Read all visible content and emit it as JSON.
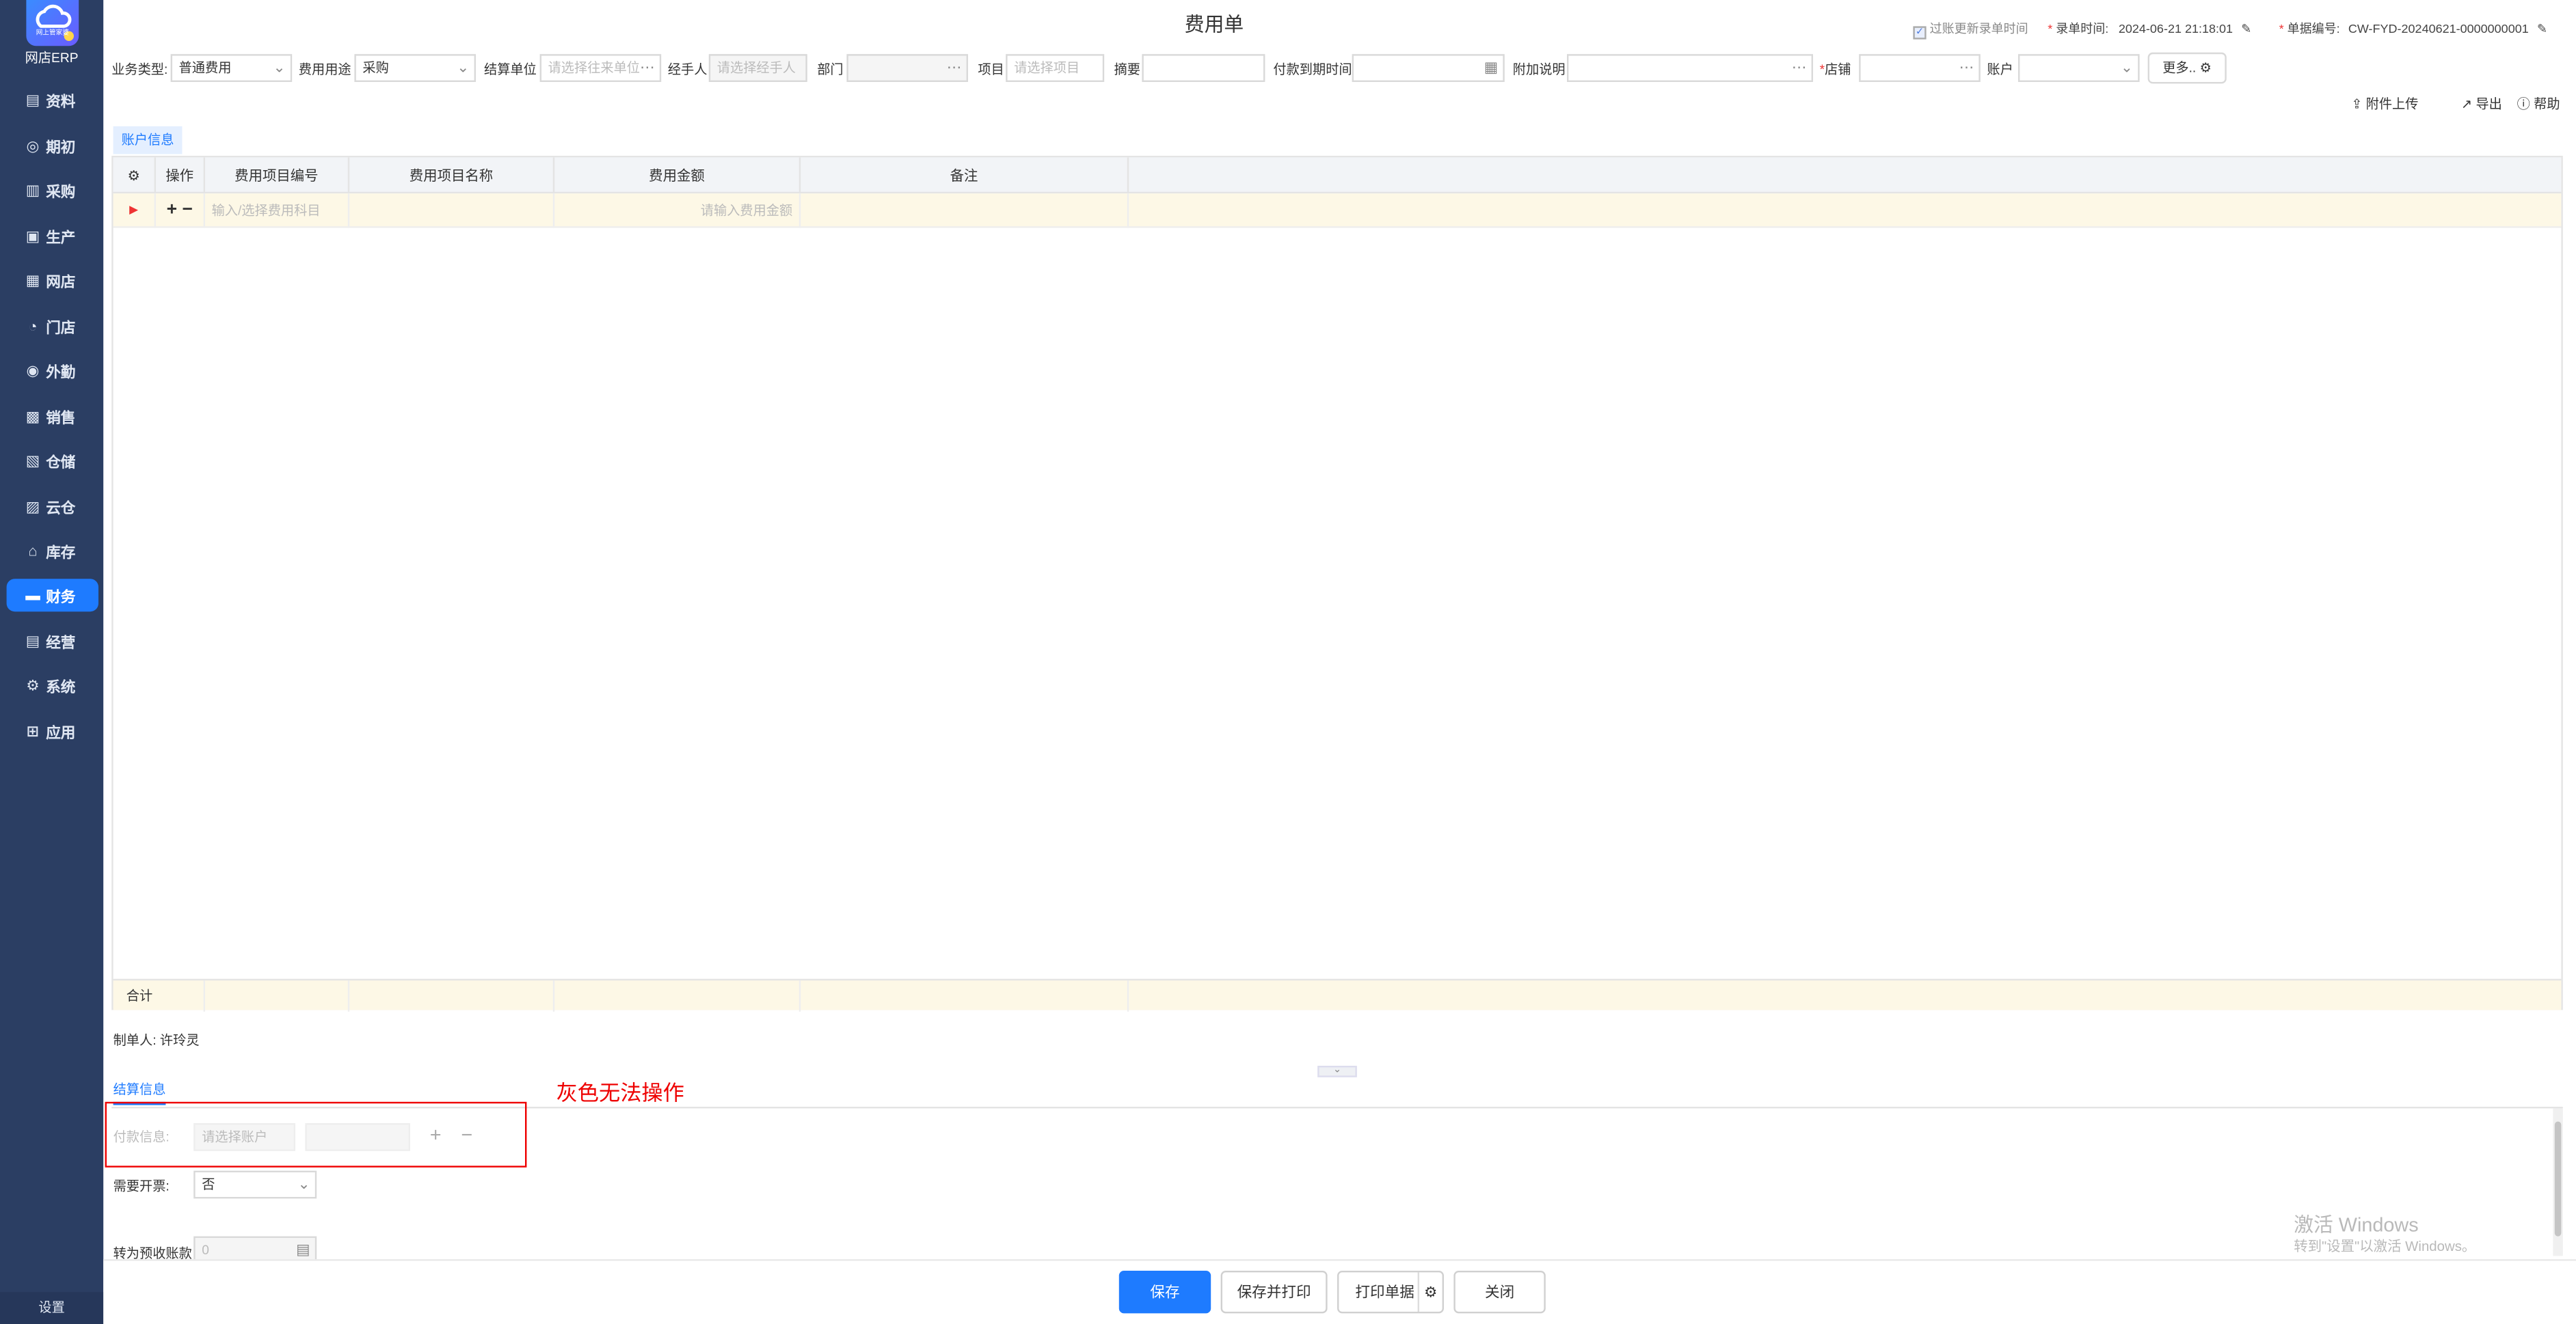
{
  "sidebar": {
    "app_name": "网店ERP",
    "logo_badge": "网上管家婆",
    "items": [
      {
        "label": "资料",
        "icon": "profile-icon"
      },
      {
        "label": "期初",
        "icon": "clock-icon"
      },
      {
        "label": "采购",
        "icon": "cart-icon"
      },
      {
        "label": "生产",
        "icon": "factory-icon"
      },
      {
        "label": "网店",
        "icon": "shop-icon"
      },
      {
        "label": "门店",
        "icon": "pie-icon"
      },
      {
        "label": "外勤",
        "icon": "location-icon"
      },
      {
        "label": "销售",
        "icon": "sales-icon"
      },
      {
        "label": "仓储",
        "icon": "warehouse-icon"
      },
      {
        "label": "云仓",
        "icon": "cloud-warehouse-icon"
      },
      {
        "label": "库存",
        "icon": "inventory-icon"
      },
      {
        "label": "财务",
        "icon": "finance-icon"
      },
      {
        "label": "经营",
        "icon": "business-icon"
      },
      {
        "label": "系统",
        "icon": "gear-icon"
      },
      {
        "label": "应用",
        "icon": "app-icon"
      }
    ],
    "active": "财务",
    "settings_label": "设置"
  },
  "header": {
    "title": "费用单",
    "checkbox_label": "过账更新录单时间",
    "entry_time_label": "录单时间:",
    "entry_time_value": "2024-06-21 21:18:01",
    "doc_no_label": "单据编号:",
    "doc_no_value": "CW-FYD-20240621-0000000001"
  },
  "form": {
    "biz_type_label": "业务类型:",
    "biz_type_value": "普通费用",
    "usage_label": "费用用途",
    "usage_value": "采购",
    "settle_unit_label": "结算单位",
    "settle_unit_placeholder": "请选择往来单位",
    "handler_label": "经手人",
    "handler_placeholder": "请选择经手人",
    "dept_label": "部门",
    "project_label": "项目",
    "project_placeholder": "请选择项目",
    "summary_label": "摘要",
    "due_date_label": "付款到期时间",
    "extra_label": "附加说明",
    "store_label": "店铺",
    "account_label": "账户",
    "more_label": "更多.."
  },
  "toolbar": {
    "attach_label": "附件上传",
    "export_label": "导出",
    "help_label": "帮助"
  },
  "table": {
    "tab_label": "账户信息",
    "columns": [
      "操作",
      "费用项目编号",
      "费用项目名称",
      "费用金额",
      "备注"
    ],
    "row_code_placeholder": "输入/选择费用科目",
    "row_amount_placeholder": "请输入费用金额",
    "total_label": "合计"
  },
  "footer": {
    "maker_label": "制单人:",
    "maker_value": "许玲灵",
    "settle_tab": "结算信息",
    "payment_label": "付款信息:",
    "payment_placeholder": "请选择账户",
    "invoice_label": "需要开票:",
    "invoice_value": "否",
    "prepay_label": "转为预收账款",
    "prepay_placeholder": "0",
    "annotation": "灰色无法操作"
  },
  "buttons": {
    "save": "保存",
    "save_print": "保存并打印",
    "print": "打印单据",
    "close": "关闭"
  },
  "watermark": {
    "line1": "激活 Windows",
    "line2": "转到\"设置\"以激活 Windows。"
  }
}
